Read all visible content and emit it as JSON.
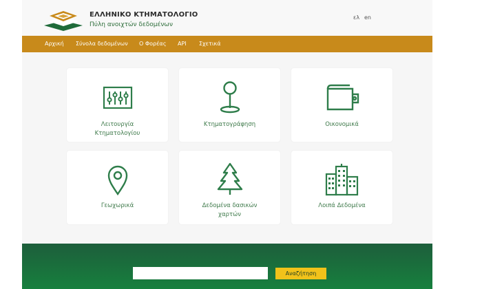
{
  "header": {
    "title": "ΕΛΛΗΝΙΚΟ ΚΤΗΜΑΤΟΛΟΓΙΟ",
    "subtitle": "Πύλη ανοιχτών δεδομένων",
    "languages": [
      "ελ",
      "en"
    ]
  },
  "nav": {
    "items": [
      "Αρχική",
      "Σύνολα δεδομένων",
      "Ο Φορέας",
      "API",
      "Σχετικά"
    ]
  },
  "cards": [
    {
      "label_lines": [
        "Λειτουργία",
        "Κτηματολογίου"
      ],
      "icon": "sliders-icon"
    },
    {
      "label_lines": [
        "Κτηματογράφηση"
      ],
      "icon": "pin-icon"
    },
    {
      "label_lines": [
        "Οικονομικά"
      ],
      "icon": "wallet-icon"
    },
    {
      "label_lines": [
        "Γεωχωρικά"
      ],
      "icon": "location-marker-icon"
    },
    {
      "label_lines": [
        "Δεδομένα δασικών",
        "χαρτών"
      ],
      "icon": "tree-icon"
    },
    {
      "label_lines": [
        "Λοιπά Δεδομένα"
      ],
      "icon": "buildings-icon"
    }
  ],
  "search": {
    "value": "",
    "placeholder": "",
    "button_label": "Αναζήτηση"
  },
  "colors": {
    "nav_bar": "#c88a1b",
    "accent_green": "#2e7d4a",
    "footer_green": "#1d6a3d",
    "search_button": "#f1c21a"
  }
}
